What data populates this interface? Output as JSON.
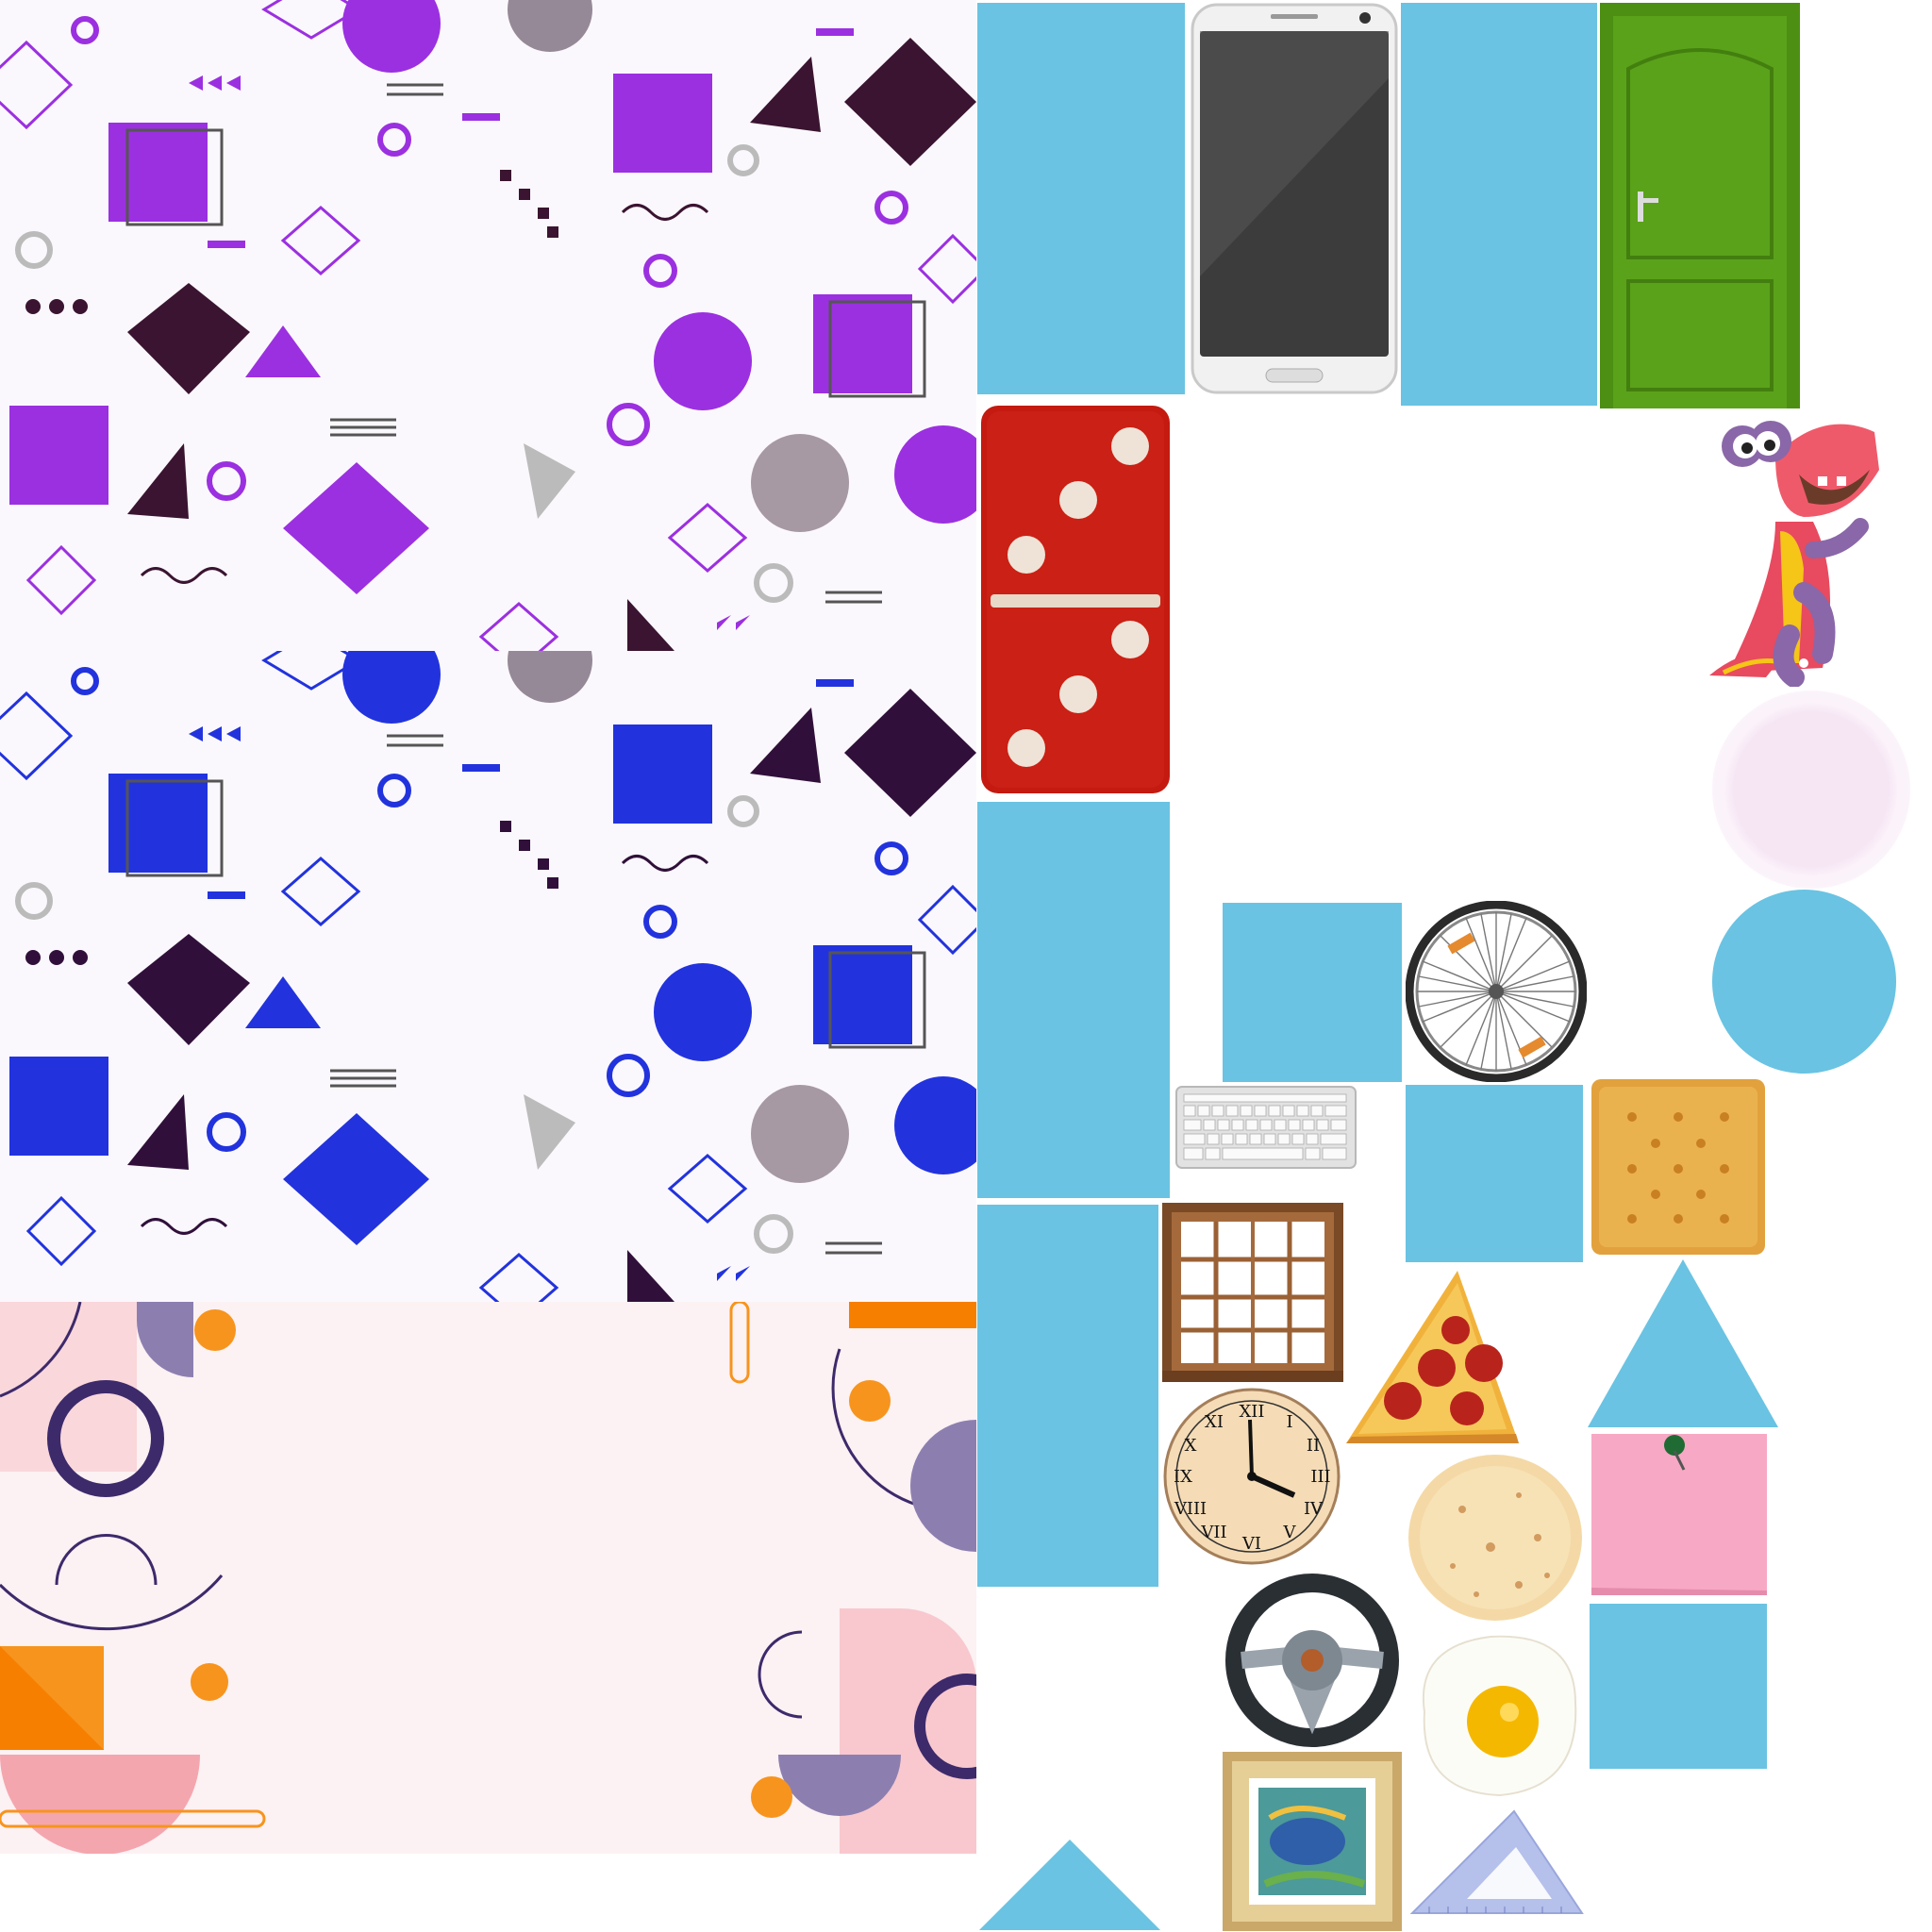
{
  "colors": {
    "shape_blue": "#6ac3e2",
    "pattern_purple": "#9b30e0",
    "pattern_blue": "#2233dd",
    "pattern_dark": "#3a1430",
    "pattern_bg": "#fbf8fd",
    "pink_panel_bg": "#fcf1f3",
    "orange": "#f7941d",
    "mauve": "#8c7fb0",
    "pink": "#f4a6ae",
    "navy_line": "#3d2a6b",
    "domino_red": "#c41a10",
    "door_green": "#5aa21a"
  },
  "panels": {
    "purple_pattern": "memphis pattern (purple)",
    "blue_pattern": "memphis pattern (blue)",
    "pink_pattern": "abstract pastel background"
  },
  "icons": [
    "smartphone-icon",
    "door-icon",
    "domino-icon",
    "dinosaur-icon",
    "bicycle-wheel-icon",
    "keyboard-icon",
    "cracker-icon",
    "window-icon",
    "pizza-slice-icon",
    "clock-icon",
    "tortilla-icon",
    "sticky-note-icon",
    "steering-wheel-icon",
    "fried-egg-icon",
    "picture-frame-icon",
    "set-square-icon"
  ]
}
